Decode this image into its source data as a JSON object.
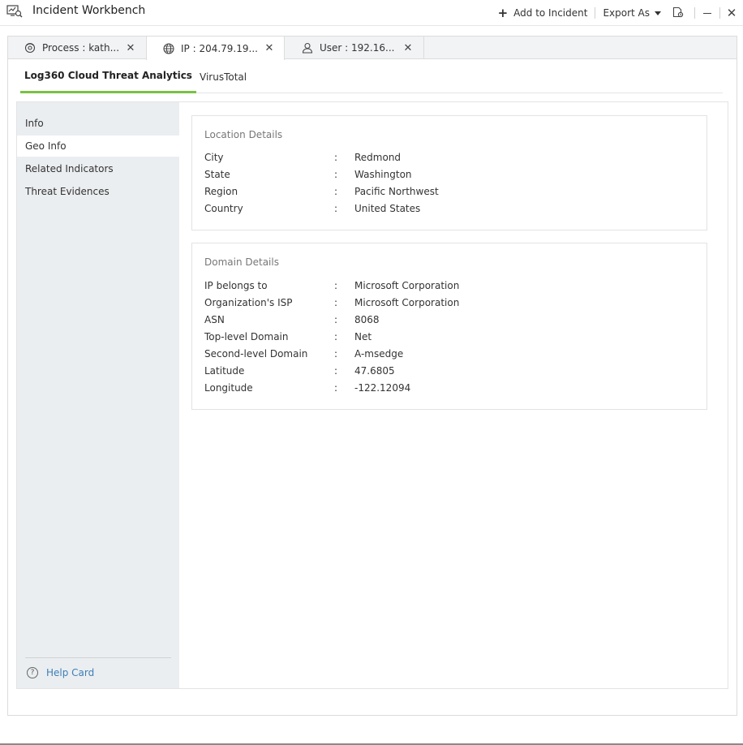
{
  "app": {
    "title": "Incident Workbench"
  },
  "toolbar": {
    "add_to_incident": "Add to Incident",
    "export_as": "Export As"
  },
  "tabs": [
    {
      "label": "Process : kath...",
      "icon": "process-icon"
    },
    {
      "label": "IP : 204.79.19...",
      "icon": "globe-icon"
    },
    {
      "label": "User : 192.16...",
      "icon": "user-icon"
    }
  ],
  "subtabs": [
    "Log360 Cloud Threat Analytics",
    "VirusTotal"
  ],
  "sidebar": {
    "items": [
      "Info",
      "Geo Info",
      "Related Indicators",
      "Threat Evidences"
    ],
    "active": "Geo Info",
    "help": "Help Card"
  },
  "location": {
    "title": "Location Details",
    "rows": [
      {
        "key": "City",
        "value": "Redmond"
      },
      {
        "key": "State",
        "value": "Washington"
      },
      {
        "key": "Region",
        "value": "Pacific Northwest"
      },
      {
        "key": "Country",
        "value": "United States"
      }
    ]
  },
  "domain": {
    "title": "Domain Details",
    "rows": [
      {
        "key": "IP belongs to",
        "value": "Microsoft Corporation"
      },
      {
        "key": "Organization's ISP",
        "value": "Microsoft Corporation"
      },
      {
        "key": "ASN",
        "value": "8068"
      },
      {
        "key": "Top-level Domain",
        "value": "Net"
      },
      {
        "key": "Second-level Domain",
        "value": "A-msedge"
      },
      {
        "key": "Latitude",
        "value": "47.6805"
      },
      {
        "key": "Longitude",
        "value": "-122.12094"
      }
    ]
  },
  "separator": ":",
  "colors": {
    "accent": "#7ac142",
    "link": "#3d7fb8",
    "sidebar_bg": "#ebeef0"
  }
}
